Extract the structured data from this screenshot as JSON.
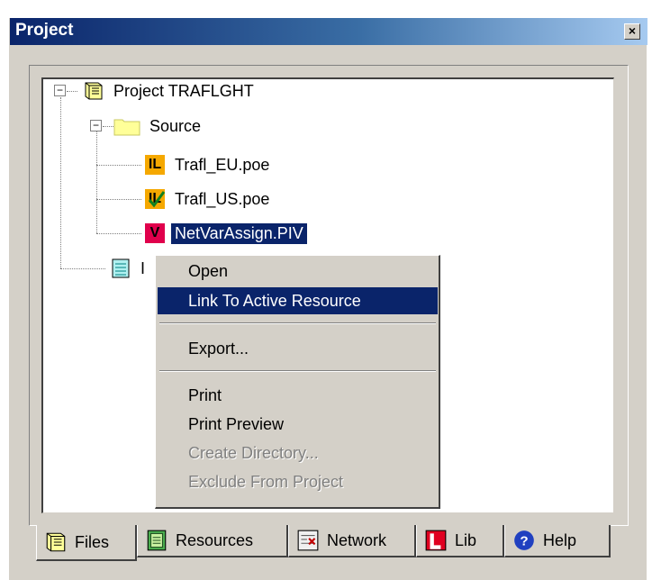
{
  "window": {
    "title": "Project",
    "close_glyph": "×"
  },
  "tree": {
    "root": {
      "label": "Project TRAFLGHT",
      "expander": "−",
      "icon": "project-book-icon"
    },
    "source": {
      "label": "Source",
      "expander": "−",
      "icon": "folder-icon"
    },
    "files": [
      {
        "label": "Trafl_EU.poe",
        "badge": "IL",
        "badge_color": "#f5a800",
        "icon": "il-file-icon"
      },
      {
        "label": "Trafl_US.poe",
        "badge": "IL",
        "badge_color": "#f5a800",
        "icon": "il-verified-file-icon"
      },
      {
        "label": "NetVarAssign.PIV",
        "badge": "V",
        "badge_color": "#e0004c",
        "icon": "v-file-icon",
        "selected": true
      }
    ],
    "partial": {
      "label": "I",
      "icon": "document-icon"
    }
  },
  "context_menu": {
    "items": [
      {
        "label": "Open",
        "state": "normal"
      },
      {
        "label": "Link To Active Resource",
        "state": "highlighted"
      },
      {
        "label": "Export...",
        "state": "normal"
      },
      {
        "label": "Print",
        "state": "normal"
      },
      {
        "label": "Print Preview",
        "state": "normal"
      },
      {
        "label": "Create Directory...",
        "state": "disabled"
      },
      {
        "label": "Exclude From Project",
        "state": "disabled"
      }
    ]
  },
  "tabs": [
    {
      "label": "Files",
      "icon": "files-book-icon",
      "active": true
    },
    {
      "label": "Resources",
      "icon": "resources-icon",
      "active": false
    },
    {
      "label": "Network",
      "icon": "network-icon",
      "active": false
    },
    {
      "label": "Lib",
      "icon": "lib-icon",
      "active": false
    },
    {
      "label": "Help",
      "icon": "help-icon",
      "active": false
    }
  ],
  "colors": {
    "title_start": "#0a246a",
    "title_end": "#a6caf0",
    "selection": "#0a246a",
    "face": "#d4d0c8"
  }
}
